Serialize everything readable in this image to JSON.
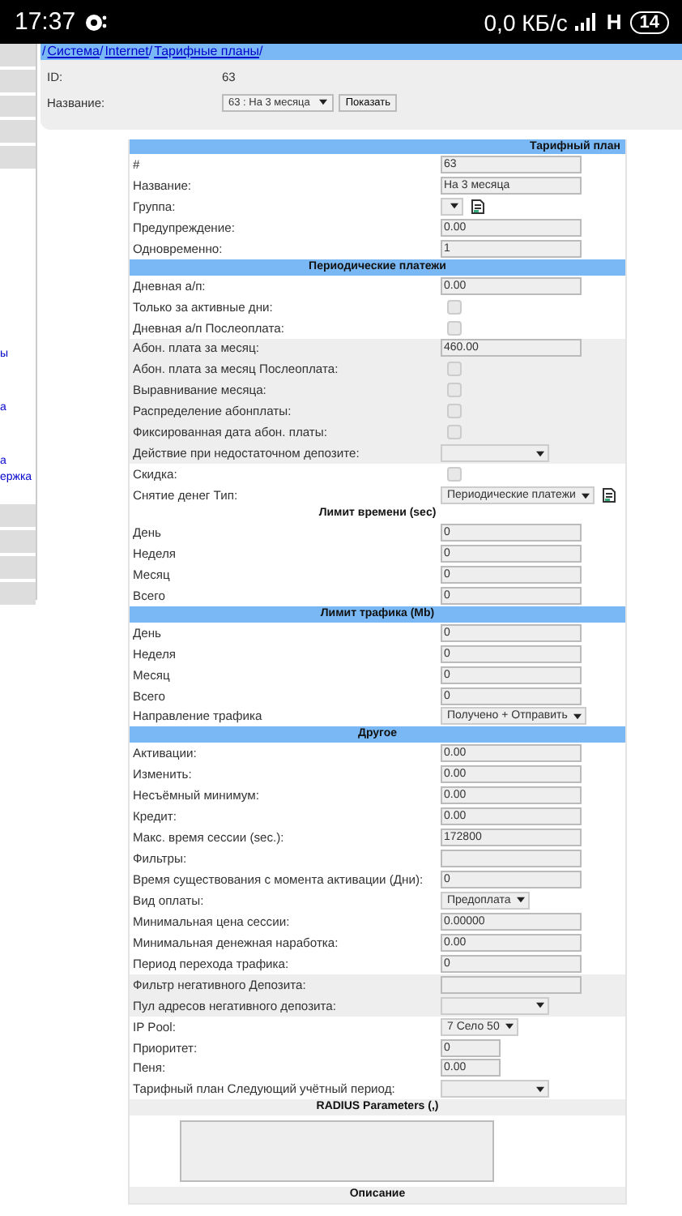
{
  "status_bar": {
    "time": "17:37",
    "speed": "0,0 КБ/с",
    "network": "H",
    "battery": "14"
  },
  "sidebar": {
    "links": [
      "ы",
      "а",
      "а",
      "ержка"
    ]
  },
  "breadcrumb": [
    {
      "kind": "sep",
      "text": "/"
    },
    {
      "kind": "link",
      "text": "Система"
    },
    {
      "kind": "sep",
      "text": "/"
    },
    {
      "kind": "link",
      "text": "Internet"
    },
    {
      "kind": "sep",
      "text": "/"
    },
    {
      "kind": "link",
      "text": "Тарифные планы"
    },
    {
      "kind": "sep",
      "text": "/"
    }
  ],
  "info": {
    "id_label": "ID:",
    "id_value": "63",
    "name_label": "Название:",
    "name_select": "63 : На 3 месяца",
    "show_button": "Показать"
  },
  "plan_table": {
    "sections": [
      {
        "title": "Тарифный план",
        "kind": "blue",
        "rows": [
          {
            "label": "#",
            "kind": "text",
            "value": "63"
          },
          {
            "label": "Название:",
            "kind": "text",
            "value": "На 3 месяца"
          },
          {
            "label": "Группа:",
            "kind": "select",
            "icon": true
          },
          {
            "label": "Предупреждение:",
            "kind": "text",
            "value": "0.00"
          },
          {
            "label": "Одновременно:",
            "kind": "text",
            "value": "1"
          }
        ]
      },
      {
        "title": "Периодические платежи",
        "kind": "blue",
        "rows": [
          {
            "label": "Дневная а/п:",
            "kind": "text",
            "value": "0.00"
          },
          {
            "label": "Только за активные дни:",
            "kind": "checkbox",
            "checked": false
          },
          {
            "label": "Дневная а/п Послеоплата:",
            "kind": "checkbox",
            "checked": false
          },
          {
            "label": "Абон. плата за месяц:",
            "kind": "text",
            "value": "460.00",
            "shaded": true
          },
          {
            "label": "Абон. плата за месяц Послеоплата:",
            "kind": "checkbox",
            "checked": false,
            "shaded": true
          },
          {
            "label": "Выравнивание месяца:",
            "kind": "checkbox",
            "checked": false,
            "shaded": true
          },
          {
            "label": "Распределение абонплаты:",
            "kind": "checkbox",
            "checked": false,
            "shaded": true
          },
          {
            "label": "Фиксированная дата абон. платы:",
            "kind": "checkbox",
            "checked": false,
            "shaded": true
          },
          {
            "label": "Действие при недостаточном депозите:",
            "kind": "select",
            "shaded": true
          },
          {
            "label": "Скидка:",
            "kind": "checkbox",
            "checked": false
          },
          {
            "label": "Снятие денег Тип:",
            "kind": "select",
            "value": "Периодические платежи",
            "icon": true
          }
        ]
      },
      {
        "title": "Лимит времени (sec)",
        "kind": "plain",
        "rows": [
          {
            "label": "День",
            "kind": "text",
            "value": "0"
          },
          {
            "label": "Неделя",
            "kind": "text",
            "value": "0"
          },
          {
            "label": "Месяц",
            "kind": "text",
            "value": "0"
          },
          {
            "label": "Всего",
            "kind": "text",
            "value": "0"
          }
        ]
      },
      {
        "title": "Лимит трафика (Mb)",
        "kind": "blue",
        "rows": [
          {
            "label": "День",
            "kind": "text",
            "value": "0"
          },
          {
            "label": "Неделя",
            "kind": "text",
            "value": "0"
          },
          {
            "label": "Месяц",
            "kind": "text",
            "value": "0"
          },
          {
            "label": "Всего",
            "kind": "text",
            "value": "0"
          },
          {
            "label": "Направление трафика",
            "kind": "select",
            "value": "Получено + Отправить"
          }
        ]
      },
      {
        "title": "Другое",
        "kind": "blue",
        "rows": [
          {
            "label": "Активации:",
            "kind": "text",
            "value": "0.00"
          },
          {
            "label": "Изменить:",
            "kind": "text",
            "value": "0.00"
          },
          {
            "label": "Несъёмный минимум:",
            "kind": "text",
            "value": "0.00"
          },
          {
            "label": "Кредит:",
            "kind": "text",
            "value": "0.00"
          },
          {
            "label": "Макс. время сессии (sec.):",
            "kind": "text",
            "value": "172800"
          },
          {
            "label": "Фильтры:",
            "kind": "text"
          },
          {
            "label": "Время существования с момента активации (Дни):",
            "kind": "text",
            "value": "0"
          },
          {
            "label": "Вид оплаты:",
            "kind": "select",
            "value": "Предоплата"
          },
          {
            "label": "Минимальная цена сессии:",
            "kind": "text",
            "value": "0.00000"
          },
          {
            "label": "Минимальная денежная наработка:",
            "kind": "text",
            "value": "0.00"
          },
          {
            "label": "Период перехода трафика:",
            "kind": "text",
            "value": "0"
          },
          {
            "label": "Фильтр негативного Депозита:",
            "kind": "text",
            "shaded": true
          },
          {
            "label": "Пул адресов негативного депозита:",
            "kind": "select",
            "shaded": true
          },
          {
            "label": "IP Pool:",
            "kind": "select",
            "value": "7 Село 50"
          },
          {
            "label": "Приоритет:",
            "kind": "short",
            "value": "0"
          },
          {
            "label": "Пеня:",
            "kind": "short",
            "value": "0.00"
          },
          {
            "label": "Тарифный план Следующий учётный период:",
            "kind": "select"
          }
        ]
      },
      {
        "title": "RADIUS Parameters (,)",
        "kind": "grey",
        "rows": [
          {
            "kind": "textarea"
          }
        ]
      },
      {
        "title": "Описание",
        "kind": "grey"
      }
    ]
  }
}
